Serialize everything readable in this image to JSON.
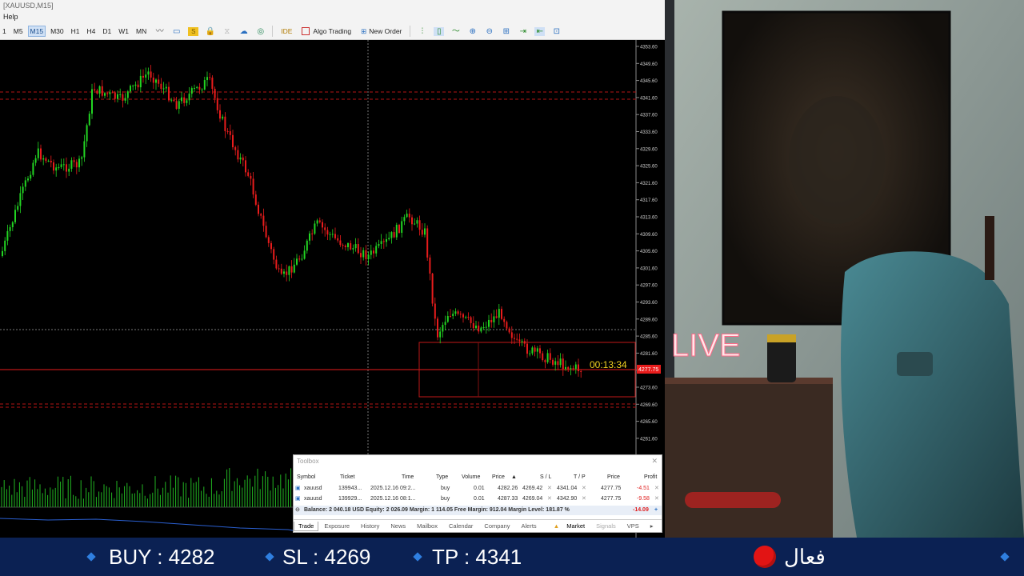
{
  "window": {
    "title": "[XAUUSD,M15]"
  },
  "menu": {
    "items": [
      "Help"
    ]
  },
  "toolbar": {
    "timeframes": [
      "1",
      "M5",
      "M15",
      "M30",
      "H1",
      "H4",
      "D1",
      "W1",
      "MN"
    ],
    "active_timeframe": "M15",
    "ide_label": "IDE",
    "algo_trading_label": "Algo Trading",
    "new_order_label": "New Order"
  },
  "chart": {
    "symbol": "XAUUSD",
    "timeframe": "M15",
    "countdown": "00:13:34",
    "price_axis": [
      "4353.60",
      "4349.60",
      "4345.60",
      "4341.60",
      "4337.60",
      "4333.60",
      "4329.60",
      "4325.60",
      "4321.60",
      "4317.60",
      "4313.60",
      "4309.60",
      "4305.60",
      "4301.60",
      "4297.60",
      "4293.60",
      "4289.60",
      "4285.60",
      "4281.60",
      "4277.60",
      "4273.60",
      "4269.60",
      "4265.60",
      "4261.60"
    ],
    "current_price_label": "4277.75",
    "colors": {
      "bull": "#22d422",
      "bear": "#e81c1c",
      "background": "#000000"
    }
  },
  "toolbox": {
    "title": "Toolbox",
    "columns": [
      "Symbol",
      "Ticket",
      "Time",
      "Type",
      "Volume",
      "Price",
      "S / L",
      "T / P",
      "Price",
      "Profit"
    ],
    "rows": [
      {
        "symbol": "xauusd",
        "ticket": "139943...",
        "time": "2025.12.16 09:2...",
        "type": "buy",
        "volume": "0.01",
        "price": "4282.26",
        "sl": "4269.42",
        "tp": "4341.04",
        "cur_price": "4277.75",
        "profit": "-4.51"
      },
      {
        "symbol": "xauusd",
        "ticket": "139929...",
        "time": "2025.12.16 08:1...",
        "type": "buy",
        "volume": "0.01",
        "price": "4287.33",
        "sl": "4269.04",
        "tp": "4342.90",
        "cur_price": "4277.75",
        "profit": "-9.58"
      }
    ],
    "summary": "Balance: 2 040.18 USD  Equity: 2 026.09  Margin: 1 114.05  Free Margin: 912.04  Margin Level: 181.87 %",
    "summary_profit": "-14.09",
    "tabs": [
      "Trade",
      "Exposure",
      "History",
      "News",
      "Mailbox",
      "Calendar",
      "Company",
      "Alerts",
      "Market",
      "Signals",
      "VPS"
    ],
    "active_tab": "Trade"
  },
  "webcam": {
    "neon_sign": "LIVE"
  },
  "bottom_bar": {
    "buy": "BUY : 4282",
    "sl": "SL : 4269",
    "tp": "TP : 4341",
    "status": "فعال"
  }
}
